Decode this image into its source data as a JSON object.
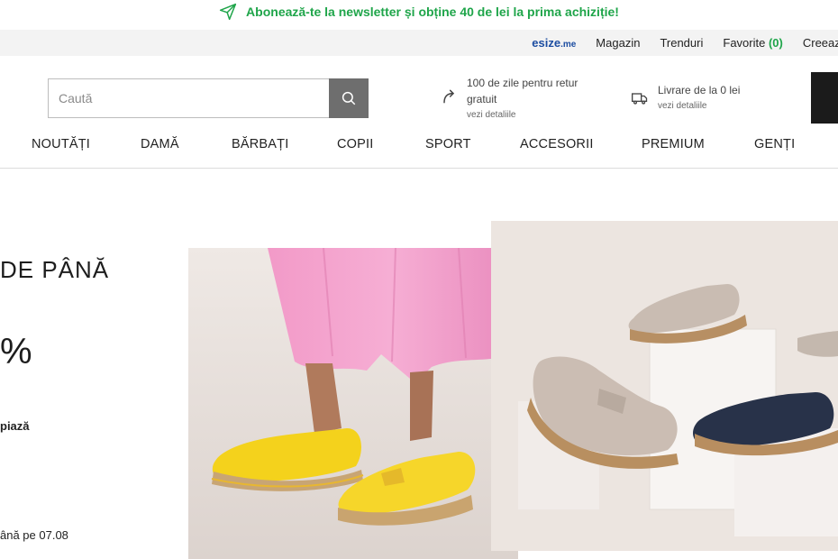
{
  "newsletter": {
    "text": "Abonează-te la newsletter și obține 40 de lei la prima achiziție!",
    "icon": "paper-plane-icon",
    "color": "#1fa54a"
  },
  "utility": {
    "esize_brand": "esize",
    "esize_suffix": ".me",
    "links": [
      "Magazin",
      "Trenduri"
    ],
    "favorites_label": "Favorite",
    "favorites_count": "(0)",
    "create_label": "Creează"
  },
  "search": {
    "placeholder": "Caută",
    "icon": "search-icon"
  },
  "returns": {
    "line1": "100 de zile pentru retur",
    "line2": "gratuit",
    "link": "vezi detaliile",
    "icon": "return-arrow-icon"
  },
  "delivery": {
    "line1": "Livrare de la 0 lei",
    "link": "vezi detaliile",
    "icon": "truck-icon"
  },
  "nav": [
    "NOUTĂȚI",
    "DAMĂ",
    "BĂRBAȚI",
    "COPII",
    "SPORT",
    "ACCESORII",
    "PREMIUM",
    "GENȚI"
  ],
  "hero": {
    "line1": "DE PÂNĂ",
    "line2": "%",
    "line3": "piază",
    "line4": "ână pe 07.08"
  },
  "colors": {
    "accent_green": "#1fa54a",
    "brand_blue": "#1c4da1",
    "nav_text": "#222222"
  }
}
